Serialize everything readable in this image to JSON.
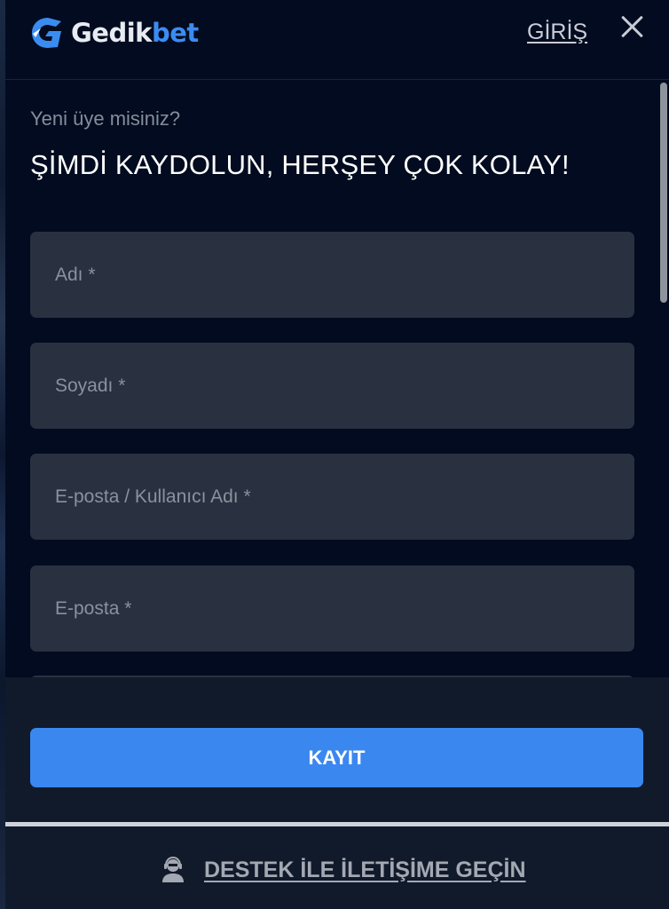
{
  "header": {
    "logo_text_part1": "Gedik",
    "logo_text_part2": "bet",
    "login_label": "GİRİŞ"
  },
  "form": {
    "subtitle": "Yeni üye misiniz?",
    "headline": "ŞİMDİ KAYDOLUN, HERŞEY ÇOK KOLAY!",
    "fields": [
      {
        "placeholder": "Adı *",
        "value": ""
      },
      {
        "placeholder": "Soyadı *",
        "value": ""
      },
      {
        "placeholder": "E-posta / Kullanıcı Adı *",
        "value": ""
      },
      {
        "placeholder": "E-posta *",
        "value": ""
      }
    ]
  },
  "footer": {
    "register_label": "KAYIT",
    "support_label": "DESTEK İLE İLETİŞİME GEÇİN"
  },
  "colors": {
    "background": "#020b1f",
    "field_background": "#29303f",
    "accent_blue": "#3b87f0",
    "footer_background": "#111a2b"
  },
  "icons": {
    "logo": "gedikbet-logo-icon",
    "close": "close-icon",
    "support": "support-agent-icon"
  }
}
